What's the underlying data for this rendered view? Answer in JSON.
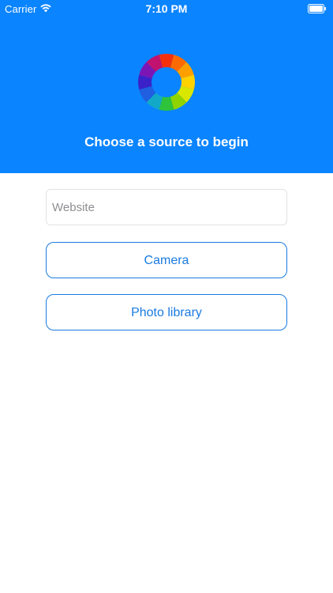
{
  "status_bar": {
    "carrier": "Carrier",
    "time": "7:10 PM",
    "icons": [
      "wifi-icon",
      "battery-icon"
    ]
  },
  "header": {
    "background_color": "#0a84ff",
    "logo_icon": "color-wheel-logo",
    "prompt": "Choose a source to begin"
  },
  "form": {
    "website_placeholder": "Website",
    "website_value": "",
    "camera_label": "Camera",
    "photo_library_label": "Photo library",
    "button_color": "#1a7be0"
  }
}
